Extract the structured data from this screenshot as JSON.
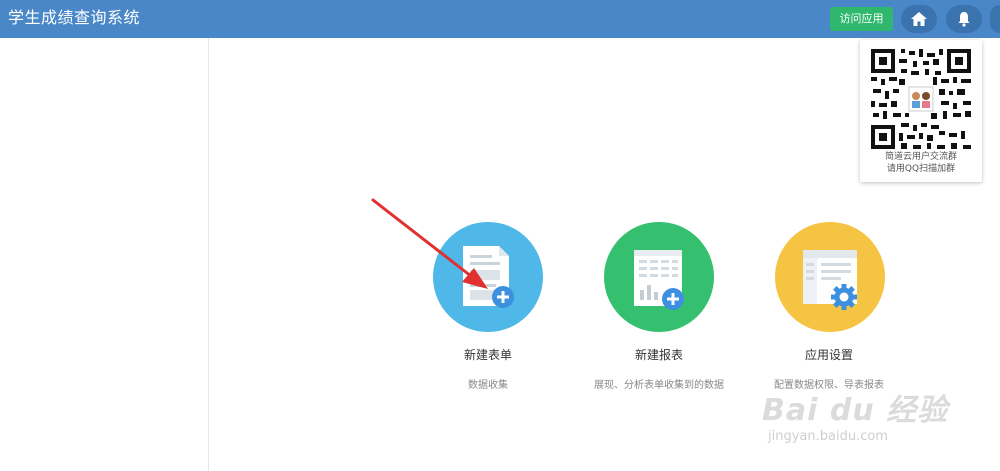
{
  "header": {
    "app_title": "学生成绩查询系统",
    "visit_app_label": "访问应用",
    "home_icon": "home-icon",
    "bell_icon": "bell-icon"
  },
  "qr_popup": {
    "line1": "简道云用户交流群",
    "line2": "请用QQ扫描加群"
  },
  "cards": [
    {
      "name": "新建表单",
      "desc": "数据收集",
      "icon": "new-form-icon",
      "color": "#4fb8e8"
    },
    {
      "name": "新建报表",
      "desc": "展现、分析表单收集到的数据",
      "icon": "new-report-icon",
      "color": "#34c06f"
    },
    {
      "name": "应用设置",
      "desc": "配置数据权限、导表报表",
      "icon": "settings-icon",
      "color": "#f6c443"
    }
  ],
  "watermark": {
    "brand": "Bai du 经验",
    "url": "jingyan.baidu.com"
  },
  "colors": {
    "header_bg": "#4a87c8",
    "visit_button": "#2fb86d",
    "annotation_arrow": "#e03030"
  }
}
